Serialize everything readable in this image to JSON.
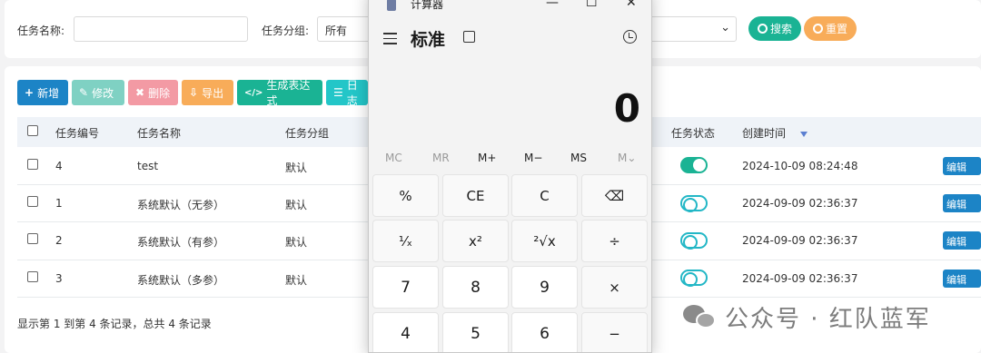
{
  "search": {
    "task_name_label": "任务名称:",
    "task_name_value": "",
    "task_group_label": "任务分组:",
    "task_group_value": "所有",
    "search_btn": "搜索",
    "reset_btn": "重置",
    "dropdown_arrow": "⌄"
  },
  "toolbar": {
    "add": "新增",
    "edit": "修改",
    "delete": "删除",
    "export": "导出",
    "gen_expr": "生成表达式",
    "log": "日志",
    "add_glyph": "+",
    "edit_glyph": "✎",
    "delete_glyph": "✖",
    "export_glyph": "⇩",
    "gen_expr_glyph": "</>",
    "log_glyph": "☰"
  },
  "table": {
    "headers": {
      "id": "任务编号",
      "name": "任务名称",
      "group": "任务分组",
      "status": "任务状态",
      "created": "创建时间"
    },
    "rows": [
      {
        "id": "4",
        "name": "test",
        "group": "默认",
        "status": "on",
        "created": "2024-10-09 08:24:48",
        "edit": "编辑"
      },
      {
        "id": "1",
        "name": "系统默认（无参）",
        "group": "默认",
        "status": "off",
        "created": "2024-09-09 02:36:37",
        "edit": "编辑"
      },
      {
        "id": "2",
        "name": "系统默认（有参）",
        "group": "默认",
        "status": "off",
        "created": "2024-09-09 02:36:37",
        "edit": "编辑"
      },
      {
        "id": "3",
        "name": "系统默认（多参）",
        "group": "默认",
        "status": "off",
        "created": "2024-09-09 02:36:37",
        "edit": "编辑"
      }
    ],
    "footer": "显示第 1 到第 4 条记录，总共 4 条记录"
  },
  "calculator": {
    "title": "计算器",
    "mode": "标准",
    "display": "0",
    "minimize": "—",
    "maximize": "☐",
    "close": "✕",
    "memory": [
      "MC",
      "MR",
      "M+",
      "M−",
      "MS",
      "M⌄"
    ],
    "keys_row1": [
      "%",
      "CE",
      "C",
      "⌫"
    ],
    "keys_row2": [
      "¹⁄ₓ",
      "x²",
      "²√x",
      "÷"
    ],
    "keys_row3": [
      "7",
      "8",
      "9",
      "×"
    ],
    "keys_row4": [
      "4",
      "5",
      "6",
      "−"
    ]
  },
  "watermark": {
    "text": "公众号 · 红队蓝军"
  },
  "colors": {
    "primary": "#1c84c6",
    "success": "#1ab394",
    "info": "#23c6c8",
    "danger": "#ed5565",
    "warning": "#f8ac59"
  }
}
